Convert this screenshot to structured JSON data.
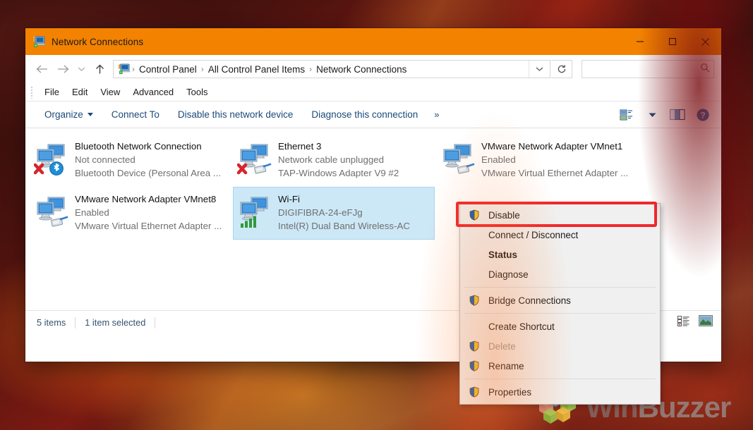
{
  "window": {
    "title": "Network Connections",
    "title_icon": "network-connections-icon",
    "minimize_label": "Minimize",
    "maximize_label": "Maximize",
    "close_label": "Close",
    "accent_color": "#f38200"
  },
  "nav": {
    "back_label": "Back",
    "forward_label": "Forward",
    "recent_label": "Recent locations",
    "up_label": "Up",
    "refresh_label": "Refresh",
    "address_dropdown_label": "Previous locations",
    "breadcrumbs": [
      {
        "label": "Control Panel"
      },
      {
        "label": "All Control Panel Items"
      },
      {
        "label": "Network Connections"
      }
    ],
    "separator": "›"
  },
  "search": {
    "value": "",
    "placeholder": "",
    "icon": "search-icon"
  },
  "menubar": {
    "items": [
      {
        "label": "File"
      },
      {
        "label": "Edit"
      },
      {
        "label": "View"
      },
      {
        "label": "Advanced"
      },
      {
        "label": "Tools"
      }
    ]
  },
  "commandbar": {
    "items": [
      {
        "label": "Organize",
        "has_caret": true
      },
      {
        "label": "Connect To",
        "has_caret": false
      },
      {
        "label": "Disable this network device",
        "has_caret": false
      },
      {
        "label": "Diagnose this connection",
        "has_caret": false
      }
    ],
    "overflow_label": "»",
    "view_icon": "change-view-icon",
    "view_caret": "chevron-down-icon",
    "preview_icon": "preview-pane-icon",
    "help_icon": "help-icon"
  },
  "connections": [
    {
      "name": "Bluetooth Network Connection",
      "status": "Not connected",
      "device": "Bluetooth Device (Personal Area ...",
      "icon": "network-adapter-icon",
      "overlay": "bluetooth-icon",
      "error": true,
      "selected": false
    },
    {
      "name": "Ethernet 3",
      "status": "Network cable unplugged",
      "device": "TAP-Windows Adapter V9 #2",
      "icon": "network-adapter-icon",
      "overlay": "ethernet-cable-icon",
      "error": true,
      "selected": false
    },
    {
      "name": "VMware Network Adapter VMnet1",
      "status": "Enabled",
      "device": "VMware Virtual Ethernet Adapter ...",
      "icon": "network-adapter-icon",
      "overlay": "ethernet-cable-icon",
      "error": false,
      "selected": false
    },
    {
      "name": "VMware Network Adapter VMnet8",
      "status": "Enabled",
      "device": "VMware Virtual Ethernet Adapter ...",
      "icon": "network-adapter-icon",
      "overlay": "ethernet-cable-icon",
      "error": false,
      "selected": false
    },
    {
      "name": "Wi-Fi",
      "status": "DIGIFIBRA-24-eFJg",
      "device": "Intel(R) Dual Band Wireless-AC",
      "icon": "network-adapter-icon",
      "overlay": "wifi-signal-icon",
      "error": false,
      "selected": true
    }
  ],
  "context_menu": {
    "highlight_color": "#f0282d",
    "items": [
      {
        "label": "Disable",
        "shield": true,
        "bold": false,
        "disabled": false,
        "highlighted": true
      },
      {
        "label": "Connect / Disconnect",
        "shield": false,
        "bold": false,
        "disabled": false,
        "highlighted": false
      },
      {
        "label": "Status",
        "shield": false,
        "bold": true,
        "disabled": false,
        "highlighted": false
      },
      {
        "label": "Diagnose",
        "shield": false,
        "bold": false,
        "disabled": false,
        "highlighted": false
      },
      {
        "separator": true
      },
      {
        "label": "Bridge Connections",
        "shield": true,
        "bold": false,
        "disabled": false,
        "highlighted": false
      },
      {
        "separator": true
      },
      {
        "label": "Create Shortcut",
        "shield": false,
        "bold": false,
        "disabled": false,
        "highlighted": false
      },
      {
        "label": "Delete",
        "shield": true,
        "bold": false,
        "disabled": true,
        "highlighted": false
      },
      {
        "label": "Rename",
        "shield": true,
        "bold": false,
        "disabled": false,
        "highlighted": false
      },
      {
        "separator": true
      },
      {
        "label": "Properties",
        "shield": true,
        "bold": false,
        "disabled": false,
        "highlighted": false
      }
    ]
  },
  "statusbar": {
    "item_count": "5 items",
    "selection": "1 item selected",
    "details_view_icon": "details-view-icon",
    "tiles_view_icon": "large-icons-view-icon"
  },
  "watermark": {
    "text_win": "Win",
    "text_buzzer": "Buzzer"
  }
}
